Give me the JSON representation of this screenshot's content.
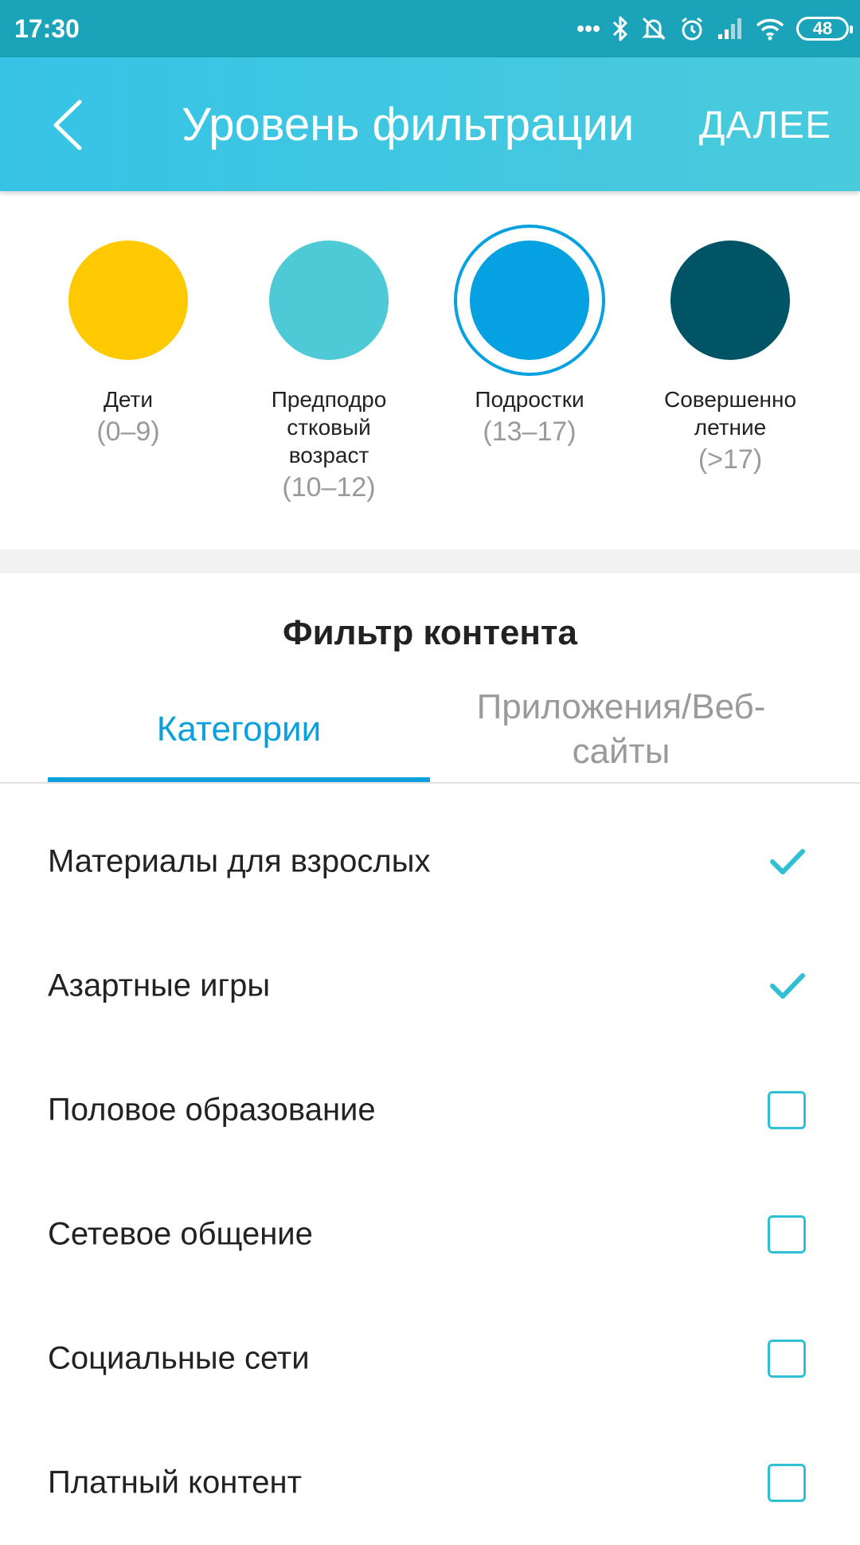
{
  "status_bar": {
    "time": "17:30",
    "battery": "48"
  },
  "header": {
    "title": "Уровень фильтрации",
    "next_label": "ДАЛЕЕ"
  },
  "levels": [
    {
      "name": "Дети",
      "age": "(0–9)",
      "color": "#ffc900",
      "selected": false
    },
    {
      "name": "Предподро\nстковый\nвозраст",
      "age": "(10–12)",
      "color": "#4ecad6",
      "selected": false
    },
    {
      "name": "Подростки",
      "age": "(13–17)",
      "color": "#06a1e0",
      "selected": true
    },
    {
      "name": "Совершенно\nлетние",
      "age": "(>17)",
      "color": "#005465",
      "selected": false
    }
  ],
  "content_filter": {
    "title": "Фильтр контента",
    "tabs": [
      {
        "label": "Категории",
        "active": true
      },
      {
        "label": "Приложения/Веб-\nсайты",
        "active": false
      }
    ],
    "items": [
      {
        "label": "Материалы для взрослых",
        "checked": true
      },
      {
        "label": "Азартные игры",
        "checked": true
      },
      {
        "label": "Половое образование",
        "checked": false
      },
      {
        "label": "Сетевое общение",
        "checked": false
      },
      {
        "label": "Социальные сети",
        "checked": false
      },
      {
        "label": "Платный контент",
        "checked": false
      }
    ]
  },
  "colors": {
    "accent": "#0aa0dd",
    "checkbox": "#2fc0d4",
    "header": "#3cc5e2"
  }
}
